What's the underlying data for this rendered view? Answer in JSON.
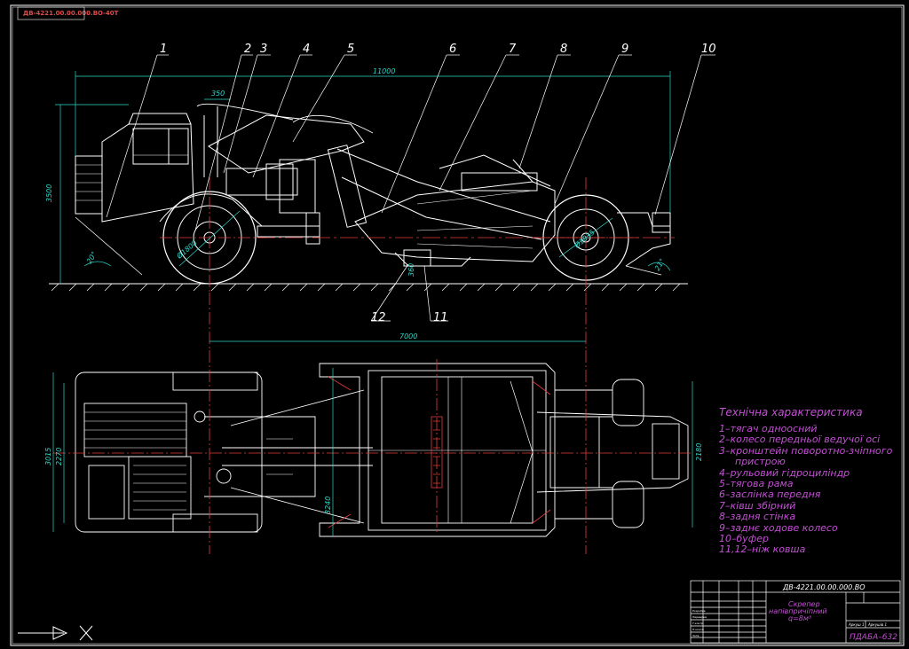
{
  "drawing": {
    "corner_stamp": "ДВ-4221.00.00.000.ВО-40Т",
    "dimensions": {
      "overall_length": "11000",
      "height": "3500",
      "cab_offset": "350",
      "wheelbase": "7000",
      "front_wheel_dia": "Ø1800",
      "rear_wheel_dia": "Ø1835",
      "cut_depth": "360",
      "approach_angle": "20°",
      "departure_angle": "21°",
      "width_3015": "3015",
      "width_2270": "2270",
      "width_2180": "2180",
      "width_3240": "3240"
    },
    "callouts": [
      "1",
      "2",
      "3",
      "4",
      "5",
      "6",
      "7",
      "8",
      "9",
      "10",
      "11",
      "12"
    ]
  },
  "legend": {
    "title": "Технічна характеристика",
    "items": [
      "1–тягач одноосний",
      "2–колесо передньої ведучої осі",
      "3–кронштейн поворотно-зчіпного",
      "пристрою",
      "4–рульовий гідроциліндр",
      "5–тягова рама",
      "6–заслінка передня",
      "7–ківш збірний",
      "8–задня стінка",
      "9–заднє ходове колесо",
      "10–буфер",
      "11,12–ніж ковша"
    ]
  },
  "title_block": {
    "doc_number": "ДВ-4221.00.00.000.ВО",
    "title_line1": "Скрепер",
    "title_line2": "напівпричіпний",
    "title_line3": "q=8м³",
    "sheet_info": "Аркуш 1",
    "sheets": "Аркушів 1",
    "org": "ПДАБА–632",
    "roles": [
      "Розробив",
      "Перевірив",
      "Т.контр.",
      "Н.контр.",
      "Затв."
    ]
  },
  "colors": {
    "outline": "#ffffff",
    "centerline": "#e23b3b",
    "dimension": "#2fd6c8",
    "leader": "#ffffff",
    "legend": "#c54fd6",
    "frame": "#ffffff"
  }
}
